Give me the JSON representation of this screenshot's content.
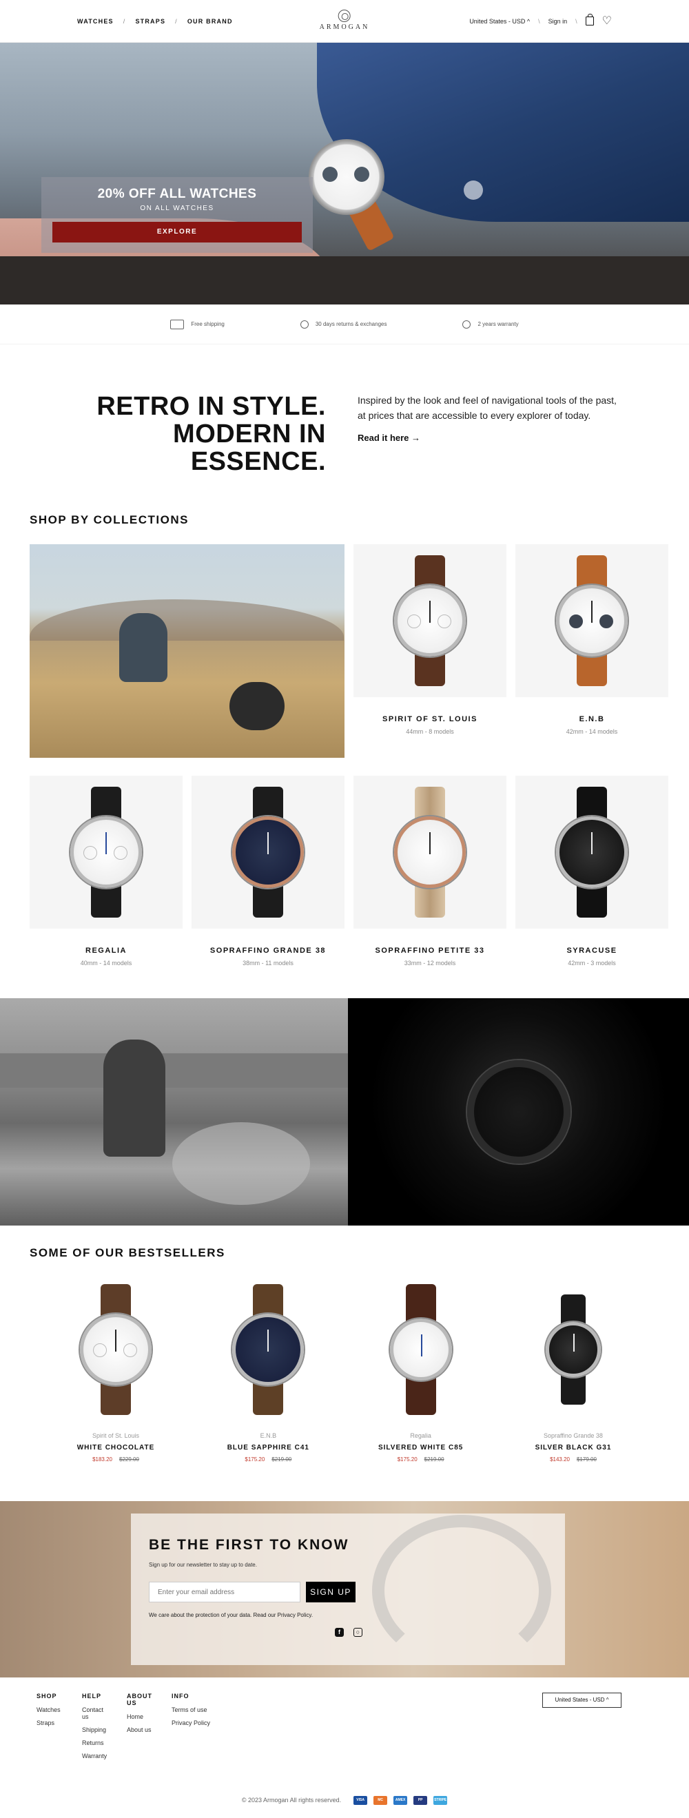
{
  "header": {
    "nav": [
      "WATCHES",
      "STRAPS",
      "OUR BRAND"
    ],
    "separator": "/",
    "logo": "ARMOGAN",
    "region": "United States - USD",
    "sign_in": "Sign in",
    "chevron": "^"
  },
  "hero": {
    "title": "20% OFF ALL WATCHES",
    "subtitle": "ON ALL WATCHES",
    "cta": "EXPLORE"
  },
  "perks": [
    "Free shipping",
    "30 days returns & exchanges",
    "2 years warranty"
  ],
  "intro": {
    "headline_1": "RETRO IN STYLE.",
    "headline_2": "MODERN IN",
    "headline_3": "ESSENCE.",
    "body": "Inspired by the look and feel of navigational tools of the past, at prices that are accessible to every explorer of today.",
    "link": "Read it here →"
  },
  "collections": {
    "title": "SHOP BY COLLECTIONS",
    "items": [
      {
        "name": "SPIRIT OF ST. LOUIS",
        "meta": "44mm - 8 models"
      },
      {
        "name": "E.N.B",
        "meta": "42mm - 14 models"
      },
      {
        "name": "REGALIA",
        "meta": "40mm - 14 models"
      },
      {
        "name": "SOPRAFFINO GRANDE 38",
        "meta": "38mm - 11 models"
      },
      {
        "name": "SOPRAFFINO PETITE 33",
        "meta": "33mm - 12 models"
      },
      {
        "name": "SYRACUSE",
        "meta": "42mm - 3 models"
      }
    ]
  },
  "bestsellers": {
    "title": "SOME OF OUR BESTSELLERS",
    "items": [
      {
        "brand": "Spirit of St. Louis",
        "name": "WHITE CHOCOLATE",
        "price": "$183.20",
        "old": "$229.00"
      },
      {
        "brand": "E.N.B",
        "name": "BLUE SAPPHIRE C41",
        "price": "$175.20",
        "old": "$219.00"
      },
      {
        "brand": "Regalia",
        "name": "SILVERED WHITE C85",
        "price": "$175.20",
        "old": "$219.00"
      },
      {
        "brand": "Sopraffino Grande 38",
        "name": "SILVER BLACK G31",
        "price": "$143.20",
        "old": "$179.00"
      }
    ]
  },
  "newsletter": {
    "title": "BE THE FIRST TO KNOW",
    "sub": "Sign up for our newsletter to stay up to date.",
    "placeholder": "Enter your email address",
    "button": "SIGN UP",
    "legal": "We care about the protection of your data. Read our Privacy Policy.",
    "social": [
      "facebook-icon",
      "instagram-icon"
    ]
  },
  "footer": {
    "columns": [
      {
        "title": "SHOP",
        "links": [
          "Watches",
          "Straps"
        ]
      },
      {
        "title": "HELP",
        "links": [
          "Contact us",
          "Shipping",
          "Returns",
          "Warranty"
        ]
      },
      {
        "title": "ABOUT US",
        "links": [
          "Home",
          "About us"
        ]
      },
      {
        "title": "INFO",
        "links": [
          "Terms of use",
          "Privacy Policy"
        ]
      }
    ],
    "region": "United States - USD ^",
    "copyright": "© 2023 Armogan All rights reserved.",
    "payments": [
      "VISA",
      "MC",
      "AMEX",
      "PP",
      "STRIPE"
    ]
  },
  "colors": {
    "accent_red": "#8a1512",
    "sale_red": "#c0392b"
  }
}
